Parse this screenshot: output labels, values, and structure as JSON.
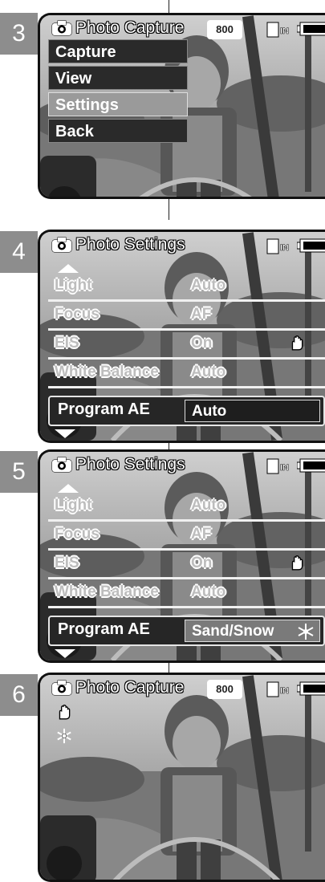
{
  "panels": [
    {
      "step": "3",
      "title": "Photo Capture",
      "resolution": "800",
      "menu": [
        "Capture",
        "View",
        "Settings",
        "Back"
      ],
      "menu_selected": 2
    },
    {
      "step": "4",
      "title": "Photo Settings",
      "settings": [
        {
          "label": "Light",
          "value": "Auto"
        },
        {
          "label": "Focus",
          "value": "AF"
        },
        {
          "label": "EIS",
          "value": "On"
        },
        {
          "label": "White Balance",
          "value": "Auto"
        }
      ],
      "active": {
        "label": "Program AE",
        "value": "Auto"
      }
    },
    {
      "step": "5",
      "title": "Photo Settings",
      "settings": [
        {
          "label": "Light",
          "value": "Auto"
        },
        {
          "label": "Focus",
          "value": "AF"
        },
        {
          "label": "EIS",
          "value": "On"
        },
        {
          "label": "White Balance",
          "value": "Auto"
        }
      ],
      "active": {
        "label": "Program AE",
        "value": "Sand/Snow"
      }
    },
    {
      "step": "6",
      "title": "Photo Capture",
      "resolution": "800"
    }
  ],
  "icons": {
    "camera": "camera-icon",
    "memory": "internal-memory-icon",
    "battery": "battery-icon",
    "eis": "hand-eis-icon",
    "snow": "snowflake-icon"
  },
  "colors": {
    "step_bg": "#8d8d8d",
    "menu_bg": "#2a2a2a",
    "menu_selected_bg": "#9a9a9a"
  }
}
